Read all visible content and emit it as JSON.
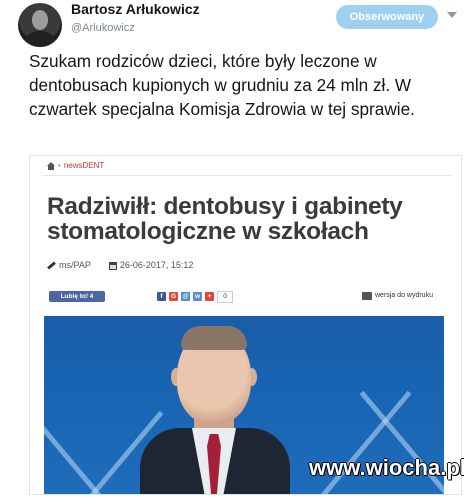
{
  "tweet": {
    "display_name": "Bartosz Arłukowicz",
    "handle": "@Arlukowicz",
    "follow_label": "Obserwowany",
    "text": "Szukam rodziców dzieci, które były leczone w dentobusach kupionych w grudniu za 24 mln zł. W czwartek specjalna Komisja Zdrowia w tej sprawie."
  },
  "article": {
    "breadcrumb_category": "newsDENT",
    "headline": "Radziwiłł: dentobusy i gabinety stomatologiczne w szkołach",
    "author": "ms/PAP",
    "date": "26-06-2017, 15:12",
    "like_label": "Lubię to! 4",
    "share_count": "0",
    "print_label": "wersja do wydruku"
  },
  "colors": {
    "follow_button": "#9fd0f2",
    "like_button": "#4a67a1",
    "hero_background": "#1764b2"
  },
  "icons": [
    "avatar",
    "home-icon",
    "pen-icon",
    "calendar-icon",
    "facebook-icon",
    "google-icon",
    "email-icon",
    "wykop-icon",
    "share-plus-icon",
    "print-icon"
  ],
  "watermark": "www.wiocha.pl"
}
